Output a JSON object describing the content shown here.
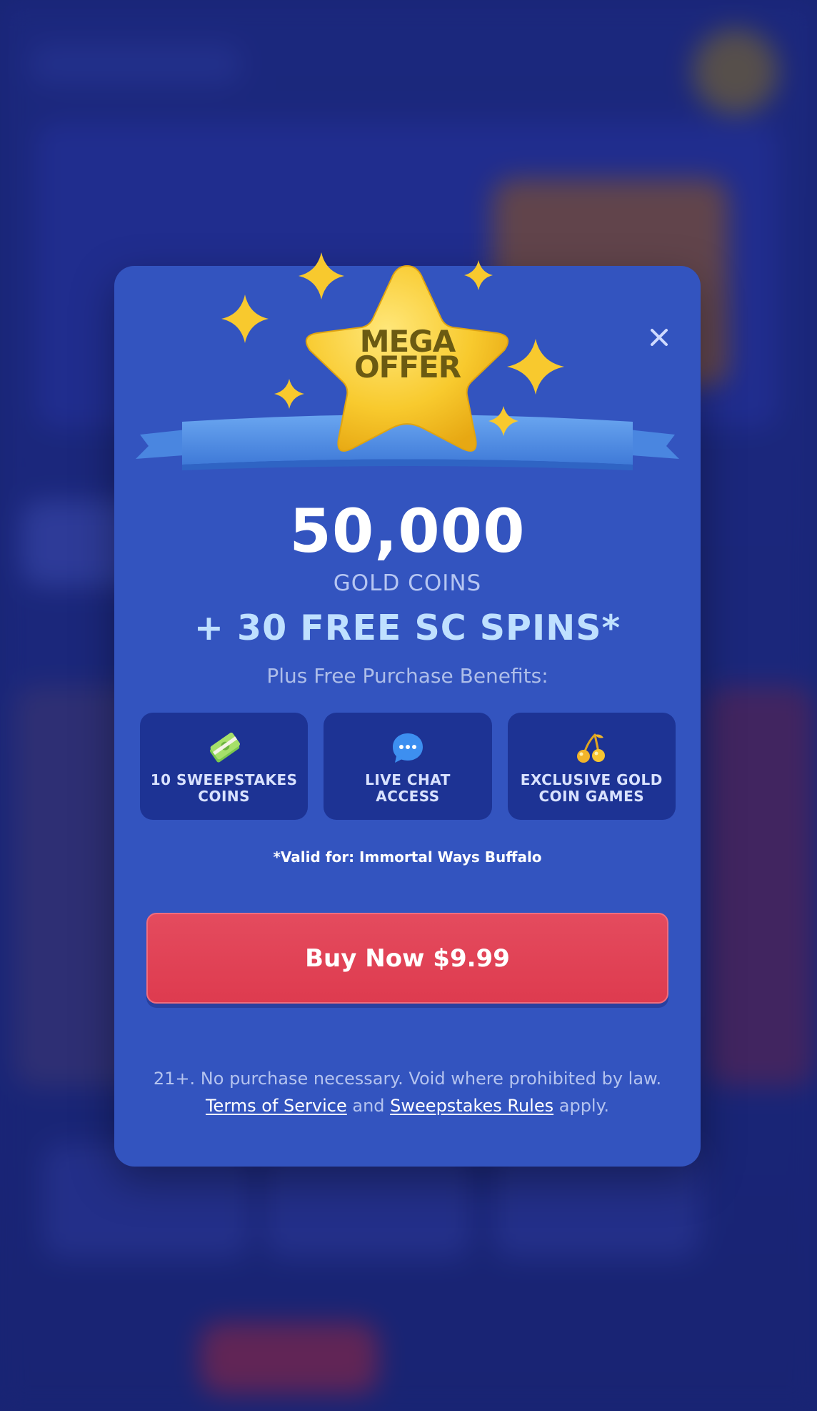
{
  "offer": {
    "badge_line1": "MEGA",
    "badge_line2": "OFFER",
    "amount": "50,000",
    "amount_label": "GOLD COINS",
    "spins": "+ 30 FREE SC SPINS*",
    "plus_text": "Plus Free Purchase Benefits:",
    "benefits": [
      {
        "label": "10 SWEEPSTAKES COINS",
        "icon": "cash-icon"
      },
      {
        "label": "LIVE CHAT ACCESS",
        "icon": "chat-bubble-icon"
      },
      {
        "label": "EXCLUSIVE GOLD COIN GAMES",
        "icon": "cherry-icon"
      }
    ],
    "valid_text": "*Valid for: Immortal Ways Buffalo",
    "buy_label": "Buy Now $9.99",
    "legal_line1": "21+. No purchase necessary. Void where prohibited by law.",
    "terms_link": "Terms of Service",
    "and_text": "and",
    "rules_link": "Sweepstakes Rules",
    "apply_text": "apply."
  },
  "colors": {
    "modal_bg": "#3354bf",
    "button": "#de3b4f",
    "benefit_bg": "#1d3394",
    "star": "#f7c93a"
  }
}
